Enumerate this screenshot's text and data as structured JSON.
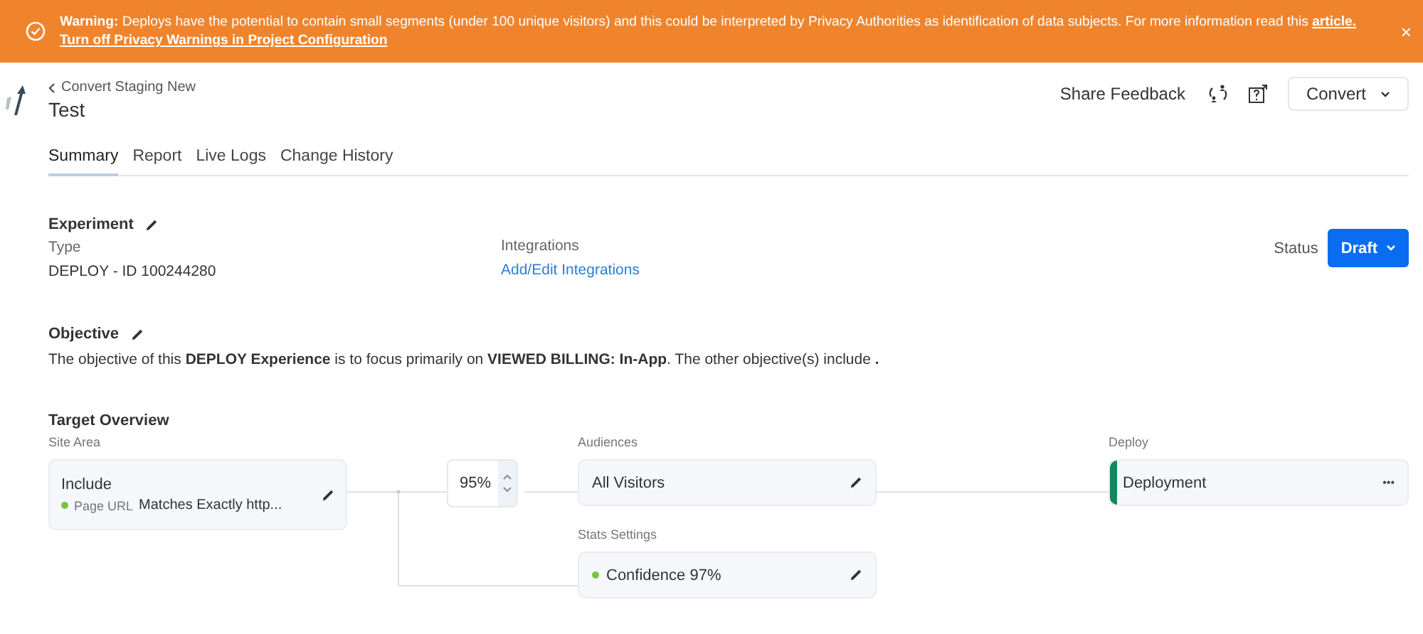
{
  "banner": {
    "text": "**Warning:** Deploys have the potential to contain small segments (under 100 unique visitors) and this could be interpreted by Privacy Authorities as identification of data subjects. For more information read this ",
    "link": "article.",
    "action": "Turn off Privacy Warnings in Project Configuration",
    "close": "×"
  },
  "header": {
    "breadcrumb": "Convert Staging New",
    "title": "Test",
    "feedback": "Share Feedback",
    "account": "Convert"
  },
  "tabs": [
    {
      "label": "Summary",
      "selected": true
    },
    {
      "label": "Report",
      "selected": false
    },
    {
      "label": "Live Logs",
      "selected": false
    },
    {
      "label": "Change History",
      "selected": false
    }
  ],
  "experiment": {
    "heading": "Experiment",
    "type_label": "Type",
    "type_value": "DEPLOY - ID 100244280",
    "integrations_label": "Integrations",
    "integrations_link": "Add/Edit Integrations",
    "status_label": "Status",
    "status_value": "Draft"
  },
  "objective": {
    "heading": "Objective",
    "text": "The objective of this **DEPLOY Experience** is to focus primarily on **VIEWED BILLING: In-App**. The other objective(s) include **.**"
  },
  "target_overview": {
    "heading": "Target Overview",
    "nodes": [
      {
        "kind": "site_area",
        "label": "Site Area",
        "title": "Include",
        "rule_key": "Page URL",
        "rule": "Matches Exactly http..."
      },
      {
        "kind": "stepper",
        "value": "95%"
      },
      {
        "kind": "audience",
        "label": "Audiences",
        "title": "All Visitors"
      },
      {
        "kind": "stats",
        "label": "Stats Settings",
        "title": "Confidence 97%"
      },
      {
        "kind": "deploy",
        "label": "Deploy",
        "title": "Deployment",
        "menu": "•••"
      }
    ]
  }
}
